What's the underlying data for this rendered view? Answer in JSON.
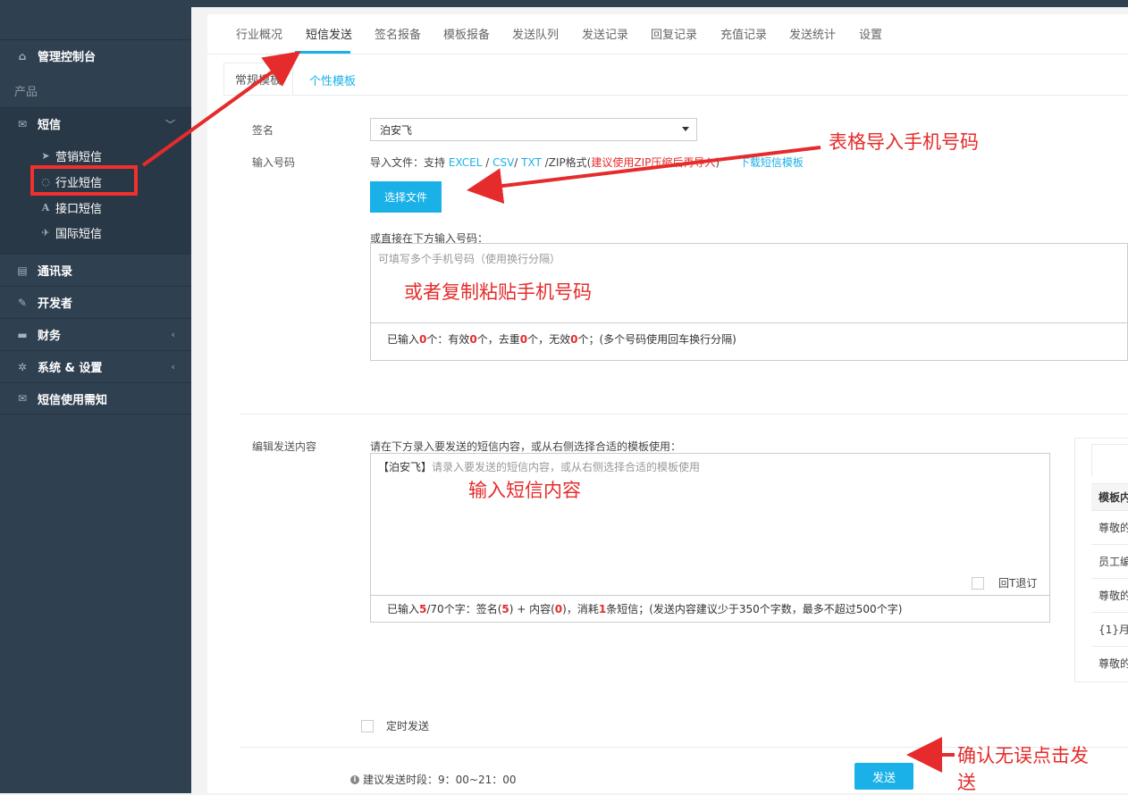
{
  "sidebar": {
    "dashboard": "管理控制台",
    "group_label": "产品",
    "sms": "短信",
    "sub_items": [
      {
        "label": "营销短信",
        "icon": "send-icon"
      },
      {
        "label": "行业短信",
        "icon": "chat-icon"
      },
      {
        "label": "接口短信",
        "icon": "font-icon"
      },
      {
        "label": "国际短信",
        "icon": "plane-icon"
      }
    ],
    "contacts": "通讯录",
    "developer": "开发者",
    "finance": "财务",
    "settings": "系统 & 设置",
    "notice": "短信使用需知"
  },
  "tabs": [
    "行业概况",
    "短信发送",
    "签名报备",
    "模板报备",
    "发送队列",
    "发送记录",
    "回复记录",
    "充值记录",
    "发送统计",
    "设置"
  ],
  "active_tab": "短信发送",
  "subtabs": {
    "normal": "常规模板",
    "personal": "个性模板"
  },
  "form": {
    "signature_label": "签名",
    "signature_value": "泊安飞",
    "number_label": "输入号码",
    "import_prefix": "导入文件：支持 ",
    "fmt_excel": "EXCEL",
    "sep1": " / ",
    "fmt_csv": "CSV",
    "sep2": "/ ",
    "fmt_txt": "TXT",
    "zip_text": " /ZIP格式(",
    "zip_advice": "建议使用ZIP压缩后再导入",
    "zip_close": ")",
    "download_template": "下载短信模板",
    "choose_file": "选择文件",
    "direct_label": "或直接在下方输入号码：",
    "phone_placeholder": "可填写多个手机号码（使用换行分隔）",
    "phone_status": {
      "p1": "已输入",
      "n1": "0",
      "p2": "个：有效",
      "n2": "0",
      "p3": "个，去重",
      "n3": "0",
      "p4": "个，无效",
      "n4": "0",
      "p5": "个；(多个号码使用回车换行分隔)"
    },
    "content_label": "编辑发送内容",
    "content_hint": "请在下方录入要发送的短信内容，或从右侧选择合适的模板使用：",
    "content_prefix": "【泊安飞】",
    "content_placeholder": "请录入要发送的短信内容，或从右侧选择合适的模板使用",
    "reply_td": "回T退订",
    "content_status": {
      "p1": "已输入",
      "n1": "5",
      "p2": "/70个字：签名(",
      "n2": "5",
      "p3": ") + 内容(",
      "n3": "0",
      "p4": ")，消耗",
      "n4": "1",
      "p5": "条短信；(发送内容建议少于350个字数，最多不超过500个字)"
    },
    "timer_label": "定时发送",
    "period": "建议发送时段：9：00~21：00",
    "send": "发送"
  },
  "template_panel": {
    "header": "模板内",
    "rows": [
      "尊敬的",
      "员工编",
      "尊敬的",
      "{1}月：",
      "尊敬的"
    ]
  },
  "annotations": {
    "import": "表格导入手机号码",
    "paste": "或者复制粘贴手机号码",
    "content": "输入短信内容",
    "confirm_line1": "确认无误点击发",
    "confirm_line2": "送"
  },
  "colors": {
    "accent": "#1ab1e8",
    "sidebar": "#2f4050",
    "annotation": "#e52b2b"
  }
}
